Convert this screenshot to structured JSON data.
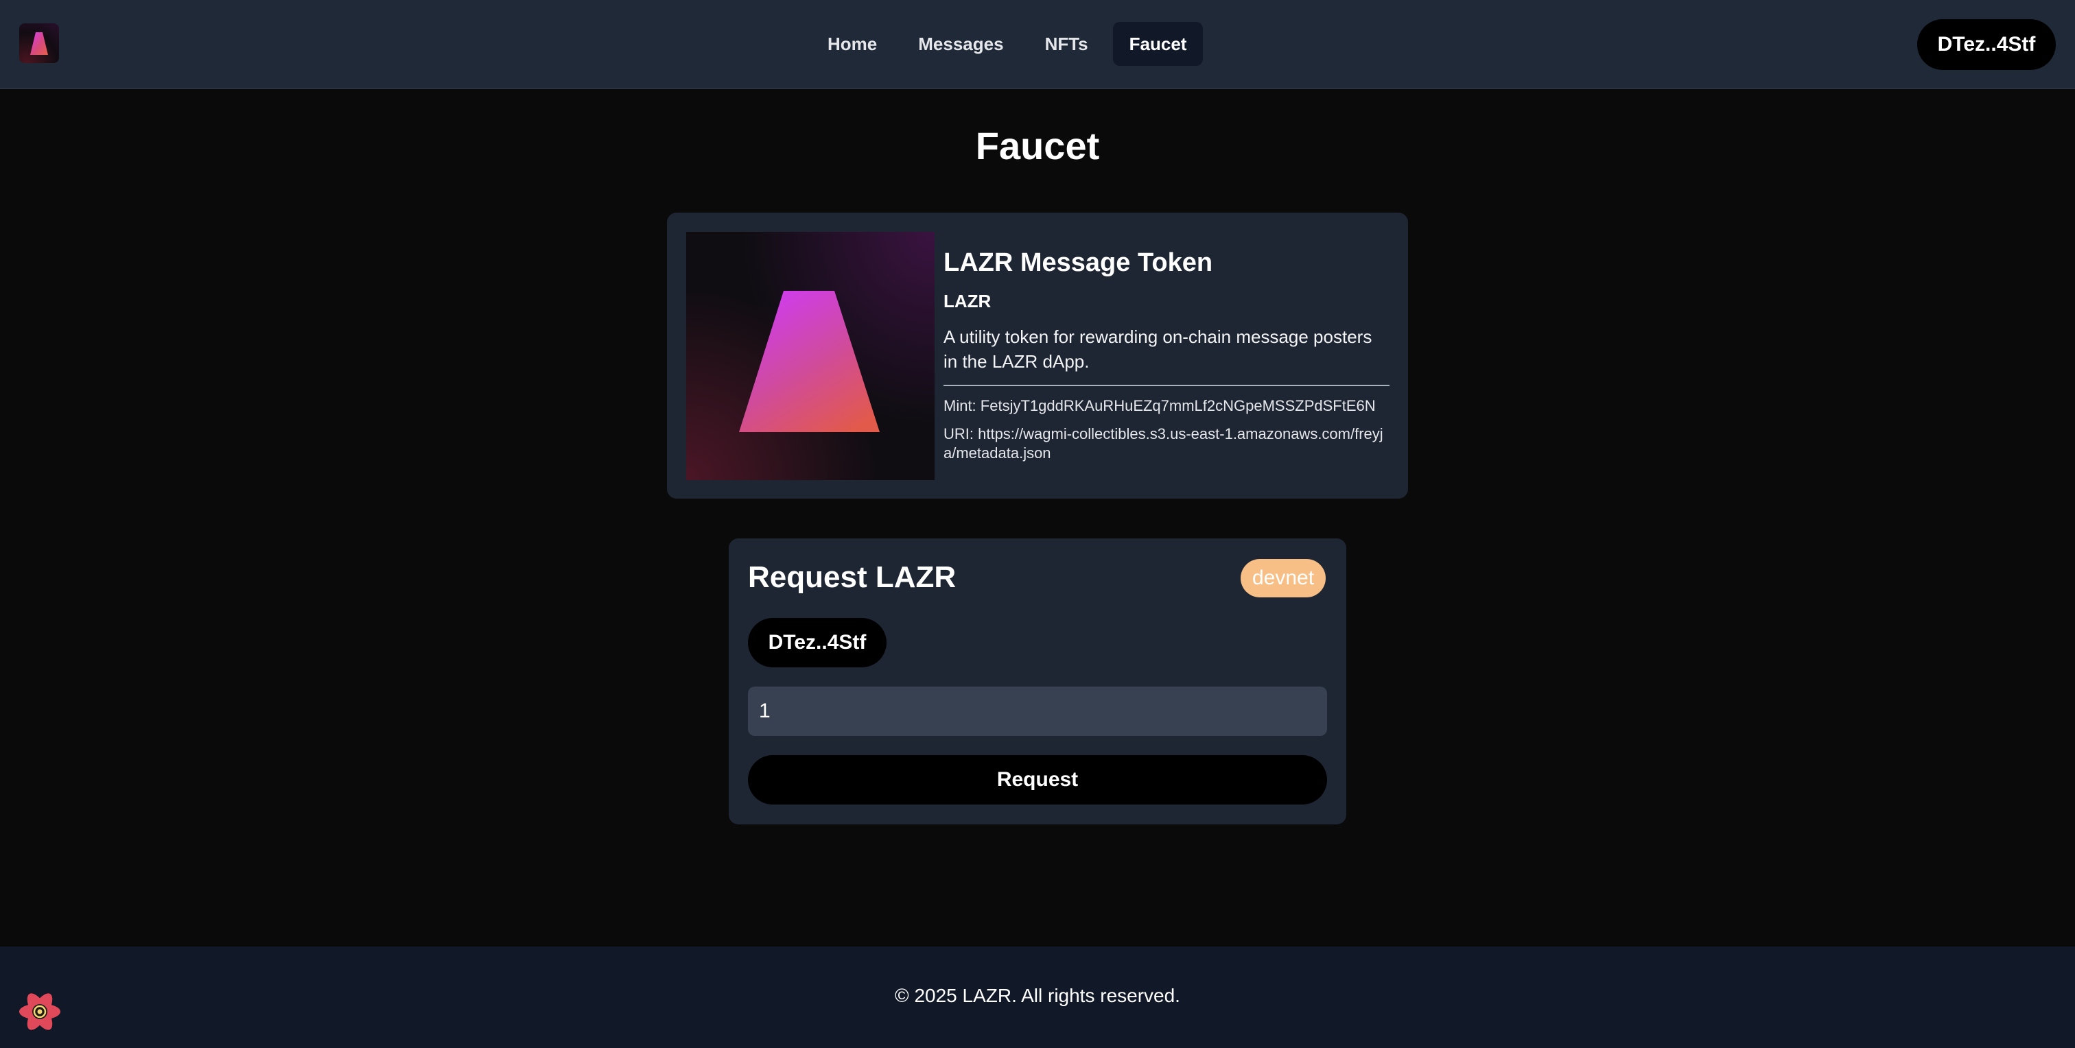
{
  "header": {
    "nav": [
      {
        "label": "Home"
      },
      {
        "label": "Messages"
      },
      {
        "label": "NFTs"
      },
      {
        "label": "Faucet",
        "active": true
      }
    ],
    "wallet_label": "DTez..4Stf"
  },
  "main": {
    "title": "Faucet",
    "token": {
      "name": "LAZR Message Token",
      "symbol": "LAZR",
      "description": "A utility token for rewarding on-chain message posters in the LAZR dApp.",
      "mint": "Mint: FetsjyT1gddRKAuRHuEZq7mmLf2cNGpeMSSZPdSFtE6N",
      "uri": "URI: https://wagmi-collectibles.s3.us-east-1.amazonaws.com/freyja/metadata.json"
    },
    "request": {
      "title": "Request LAZR",
      "network": "devnet",
      "address": "DTez..4Stf",
      "amount": "1",
      "button_label": "Request"
    }
  },
  "footer": {
    "copyright": "© 2025 LAZR. All rights reserved."
  },
  "colors": {
    "header_bg": "#1f2937",
    "page_bg": "#0a0a0a",
    "card_bg": "#1f2633",
    "badge": "#f7be85",
    "input_bg": "#374151",
    "footer_bg": "#111827"
  },
  "icons": {
    "logo": "lazr-trapezoid-logo",
    "token_image": "lazr-trapezoid-logo",
    "footer": "react-atom-icon"
  }
}
